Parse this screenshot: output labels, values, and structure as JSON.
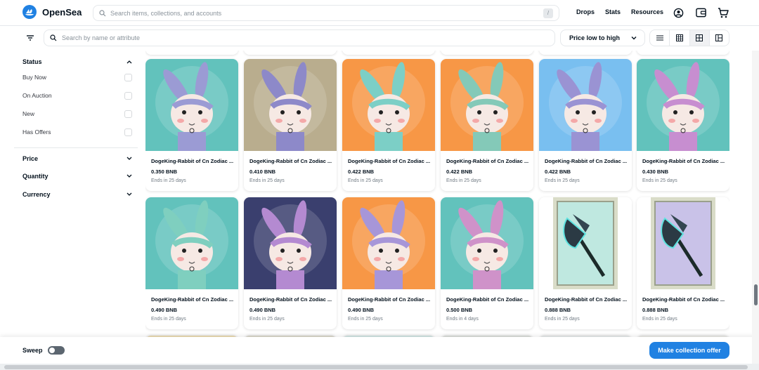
{
  "header": {
    "brand": "OpenSea",
    "search_placeholder": "Search items, collections, and accounts",
    "search_shortcut": "/",
    "nav": [
      "Drops",
      "Stats",
      "Resources"
    ]
  },
  "filterbar": {
    "search_placeholder": "Search by name or attribute",
    "sort_label": "Price low to high",
    "views": [
      "list-view",
      "grid-small",
      "grid-medium",
      "grid-large"
    ],
    "active_view": "grid-medium"
  },
  "sidebar": {
    "status_title": "Status",
    "status_items": [
      "Buy Now",
      "On Auction",
      "New",
      "Has Offers"
    ],
    "price_title": "Price",
    "quantity_title": "Quantity",
    "currency_title": "Currency"
  },
  "cards": [
    {
      "title": "DogeKing-Rabbit of Cn Zodiac ...",
      "price": "0.350 BNB",
      "ends": "Ends in 25 days",
      "bg": "#62c2bc",
      "body": "#9b9bd4",
      "art": "rabbit"
    },
    {
      "title": "DogeKing-Rabbit of Cn Zodiac ...",
      "price": "0.410 BNB",
      "ends": "Ends in 25 days",
      "bg": "#b9ad8e",
      "body": "#8d89c9",
      "art": "rabbit"
    },
    {
      "title": "DogeKing-Rabbit of Cn Zodiac ...",
      "price": "0.422 BNB",
      "ends": "Ends in 25 days",
      "bg": "#f79746",
      "body": "#7ccfc6",
      "art": "rabbit"
    },
    {
      "title": "DogeKing-Rabbit of Cn Zodiac ...",
      "price": "0.422 BNB",
      "ends": "Ends in 25 days",
      "bg": "#f79746",
      "body": "#84c9b8",
      "art": "rabbit"
    },
    {
      "title": "DogeKing-Rabbit of Cn Zodiac ...",
      "price": "0.422 BNB",
      "ends": "Ends in 25 days",
      "bg": "#79bff0",
      "body": "#9a93d3",
      "art": "rabbit"
    },
    {
      "title": "DogeKing-Rabbit of Cn Zodiac ...",
      "price": "0.430 BNB",
      "ends": "Ends in 25 days",
      "bg": "#62c2bc",
      "body": "#c78ed0",
      "art": "rabbit"
    },
    {
      "title": "DogeKing-Rabbit of Cn Zodiac ...",
      "price": "0.490 BNB",
      "ends": "Ends in 25 days",
      "bg": "#62c2bc",
      "body": "#7fcfbf",
      "art": "rabbit"
    },
    {
      "title": "DogeKing-Rabbit of Cn Zodiac ...",
      "price": "0.490 BNB",
      "ends": "Ends in 25 days",
      "bg": "#3a3f6e",
      "body": "#b48ad1",
      "art": "rabbit"
    },
    {
      "title": "DogeKing-Rabbit of Cn Zodiac ...",
      "price": "0.490 BNB",
      "ends": "Ends in 25 days",
      "bg": "#f79746",
      "body": "#a796d8",
      "art": "rabbit"
    },
    {
      "title": "DogeKing-Rabbit of Cn Zodiac ...",
      "price": "0.500 BNB",
      "ends": "Ends in 4 days",
      "bg": "#62c2bc",
      "body": "#cf92c9",
      "art": "rabbit"
    },
    {
      "title": "DogeKing-Rabbit of Cn Zodiac ...",
      "price": "0.888 BNB",
      "ends": "Ends in 25 days",
      "bg": "#ffffff",
      "body": "#bfe8e0",
      "art": "axe"
    },
    {
      "title": "DogeKing-Rabbit of Cn Zodiac ...",
      "price": "0.888 BNB",
      "ends": "Ends in 25 days",
      "bg": "#ffffff",
      "body": "#c9c2e8",
      "art": "axe"
    }
  ],
  "bottombar": {
    "sweep_label": "Sweep",
    "offer_button": "Make collection offer"
  },
  "colors": {
    "accent": "#2081e2",
    "text": "#04111d",
    "muted": "#707a83",
    "border": "#e5e8eb"
  }
}
